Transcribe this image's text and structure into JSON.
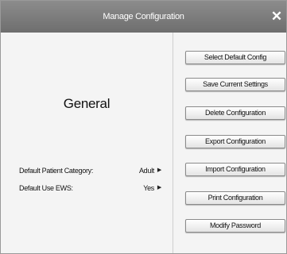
{
  "window": {
    "title": "Manage Configuration",
    "close_glyph": "✕"
  },
  "section": {
    "title": "General"
  },
  "settings": [
    {
      "label": "Default Patient Category:",
      "value": "Adult",
      "arrow": "▶"
    },
    {
      "label": "Default Use EWS:",
      "value": "Yes",
      "arrow": "▶"
    }
  ],
  "actions": [
    {
      "label": "Select Default Config"
    },
    {
      "label": "Save Current Settings"
    },
    {
      "label": "Delete Configuration"
    },
    {
      "label": "Export Configuration"
    },
    {
      "label": "Import Configuration"
    },
    {
      "label": "Print Configuration"
    },
    {
      "label": "Modify Password"
    }
  ],
  "colors": {
    "titlebar": "#7d7d7d",
    "background": "#f4f4f4"
  }
}
